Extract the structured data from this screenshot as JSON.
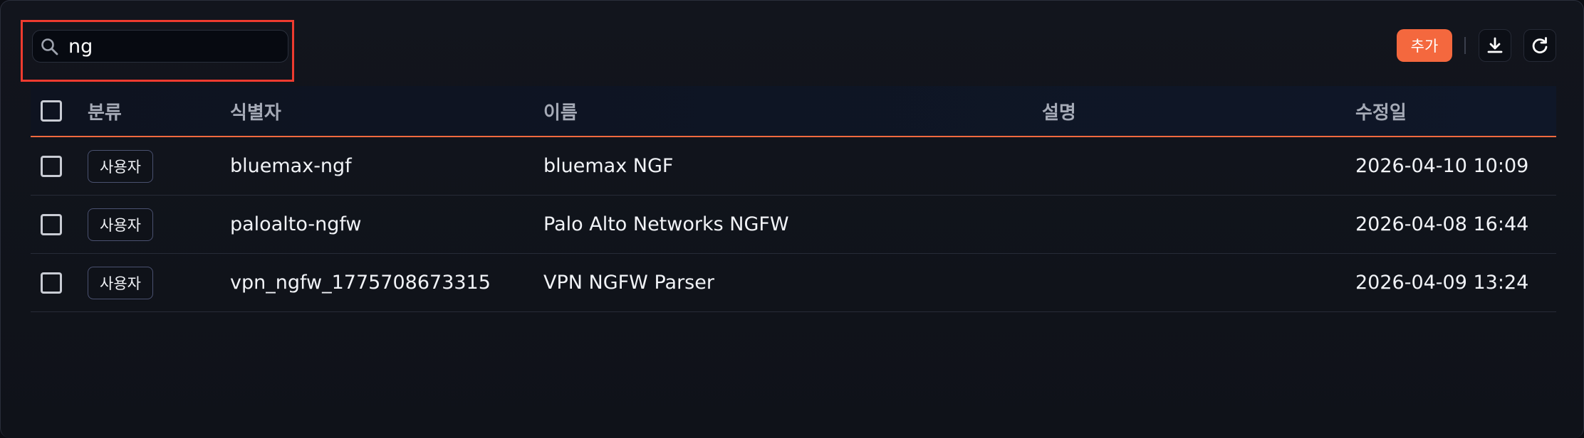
{
  "search": {
    "value": "ng"
  },
  "toolbar": {
    "add_label": "추가"
  },
  "table": {
    "headers": {
      "category": "분류",
      "identifier": "식별자",
      "name": "이름",
      "description": "설명",
      "modified": "수정일"
    },
    "rows": [
      {
        "category": "사용자",
        "identifier": "bluemax-ngf",
        "name": "bluemax NGF",
        "description": "",
        "modified": "2026-04-10 10:09"
      },
      {
        "category": "사용자",
        "identifier": "paloalto-ngfw",
        "name": "Palo Alto Networks NGFW",
        "description": "",
        "modified": "2026-04-08 16:44"
      },
      {
        "category": "사용자",
        "identifier": "vpn_ngfw_1775708673315",
        "name": "VPN NGFW Parser",
        "description": "",
        "modified": "2026-04-09 13:24"
      }
    ]
  },
  "icons": {
    "search": "search-icon",
    "download": "download-icon",
    "refresh": "refresh-icon"
  },
  "colors": {
    "accent": "#f4683e",
    "highlight": "#ee3b2f",
    "background": "#0f1219"
  }
}
